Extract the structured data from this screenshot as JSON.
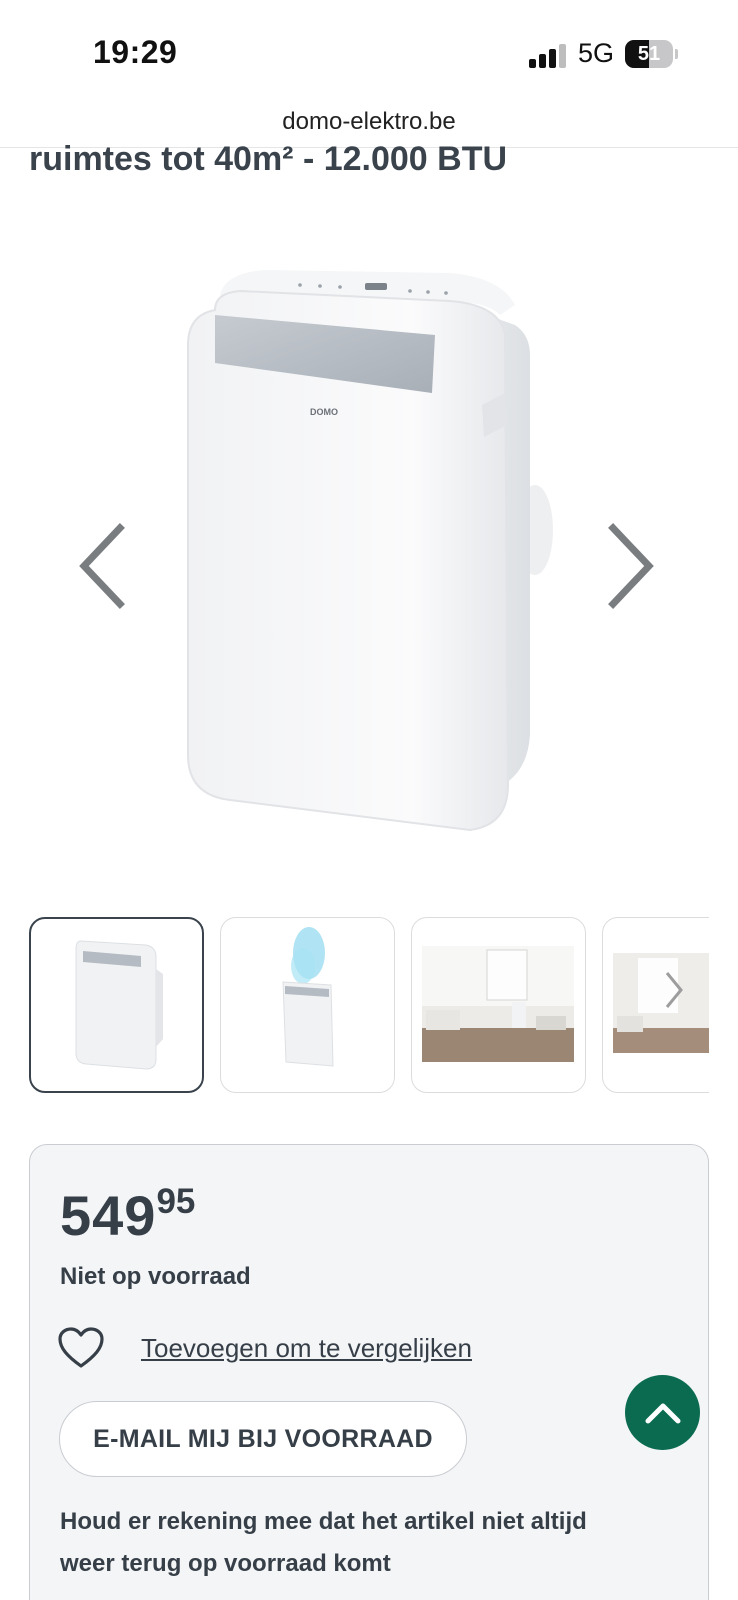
{
  "status_bar": {
    "time": "19:29",
    "network": "5G",
    "battery": "51",
    "battery_level": 0.51
  },
  "browser": {
    "url": "domo-elektro.be"
  },
  "product": {
    "title_fragment": "ruimtes tot 40m² - 12.000 BTU",
    "brand_logo": "DOMO",
    "price_euros": "549",
    "price_cents": "95",
    "stock_status": "Niet op voorraad",
    "compare_label": "Toevoegen om te vergelijken",
    "email_button_label": "E-MAIL MIJ BIJ VOORRAAD",
    "notice": "Houd er rekening mee dat het artikel niet altijd weer terug op voorraad komt"
  },
  "gallery": {
    "prev_icon": "chevron-left-icon",
    "next_icon": "chevron-right-icon",
    "thumbnails": [
      "airco-front",
      "airco-cooling",
      "living-room",
      "living-room-2"
    ],
    "active_thumbnail": 0
  },
  "colors": {
    "text": "#363f48",
    "accent": "#0b6b50",
    "card_bg": "#f4f5f7"
  },
  "icons": {
    "compare": "heart-icon",
    "scroll_top": "chevron-up-icon"
  }
}
